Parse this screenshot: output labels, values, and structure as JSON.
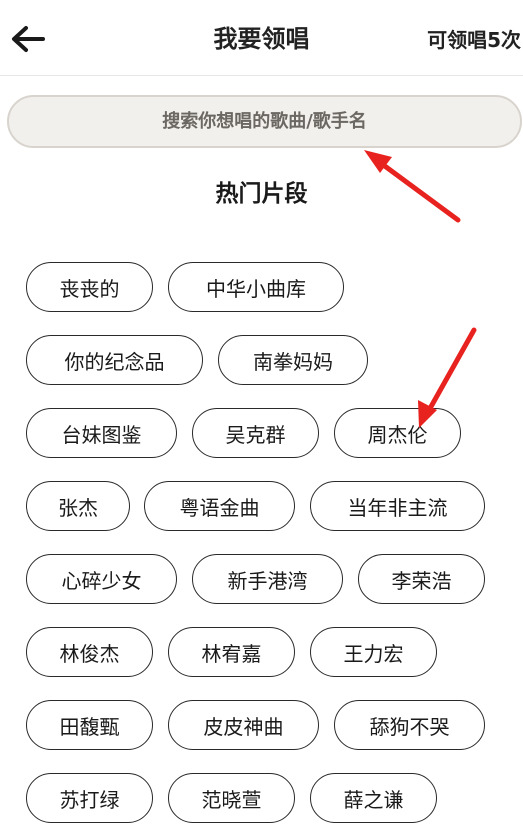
{
  "header": {
    "back_icon": "arrow-left-icon",
    "title": "我要领唱",
    "quota_label": "可领唱5次"
  },
  "search": {
    "placeholder": "搜索你想唱的歌曲/歌手名",
    "value": ""
  },
  "section": {
    "title": "热门片段"
  },
  "tags": [
    [
      "丧丧的",
      "中华小曲库"
    ],
    [
      "你的纪念品",
      "南拳妈妈"
    ],
    [
      "台妹图鉴",
      "吴克群",
      "周杰伦"
    ],
    [
      "张杰",
      "粤语金曲",
      "当年非主流"
    ],
    [
      "心碎少女",
      "新手港湾",
      "李荣浩"
    ],
    [
      "林俊杰",
      "林宥嘉",
      "王力宏"
    ],
    [
      "田馥甄",
      "皮皮神曲",
      "舔狗不哭"
    ],
    [
      "苏打绿",
      "范晓萱",
      "薛之谦"
    ]
  ],
  "annotations": {
    "arrow_color": "#e8231f"
  }
}
